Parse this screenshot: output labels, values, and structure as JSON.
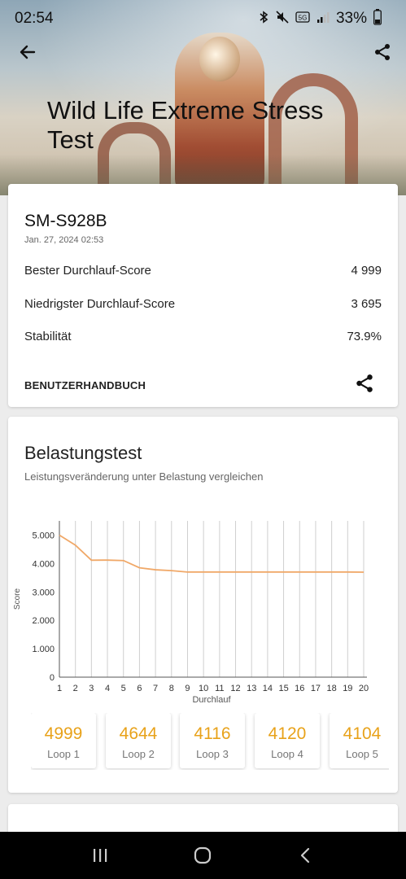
{
  "status": {
    "time": "02:54",
    "battery": "33%"
  },
  "header": {
    "title": "Wild Life Extreme Stress Test"
  },
  "result": {
    "device": "SM-S928B",
    "date": "Jan. 27, 2024 02:53",
    "rows": [
      {
        "label": "Bester Durchlauf-Score",
        "value": "4 999"
      },
      {
        "label": "Niedrigster Durchlauf-Score",
        "value": "3 695"
      },
      {
        "label": "Stabilität",
        "value": "73.9%"
      }
    ],
    "manual_label": "BENUTZERHANDBUCH"
  },
  "stress": {
    "title": "Belastungstest",
    "subtitle": "Leistungsveränderung unter Belastung vergleichen",
    "loops": [
      {
        "value": "4999",
        "label": "Loop 1"
      },
      {
        "value": "4644",
        "label": "Loop 2"
      },
      {
        "value": "4116",
        "label": "Loop 3"
      },
      {
        "value": "4120",
        "label": "Loop 4"
      },
      {
        "value": "4104",
        "label": "Loop 5"
      }
    ]
  },
  "chart_data": {
    "type": "line",
    "xlabel": "Durchlauf",
    "ylabel": "Score",
    "x": [
      1,
      2,
      3,
      4,
      5,
      6,
      7,
      8,
      9,
      10,
      11,
      12,
      13,
      14,
      15,
      16,
      17,
      18,
      19,
      20
    ],
    "ylim": [
      0,
      5500
    ],
    "yticks": [
      "0",
      "1.000",
      "2.000",
      "3.000",
      "4.000",
      "5.000"
    ],
    "ytick_values": [
      0,
      1000,
      2000,
      3000,
      4000,
      5000
    ],
    "series": [
      {
        "values": [
          4999,
          4644,
          4116,
          4120,
          4104,
          3850,
          3780,
          3750,
          3700,
          3700,
          3700,
          3700,
          3700,
          3700,
          3700,
          3700,
          3700,
          3700,
          3700,
          3695
        ]
      }
    ],
    "line_color": "#f0a868",
    "grid": "vertical"
  }
}
